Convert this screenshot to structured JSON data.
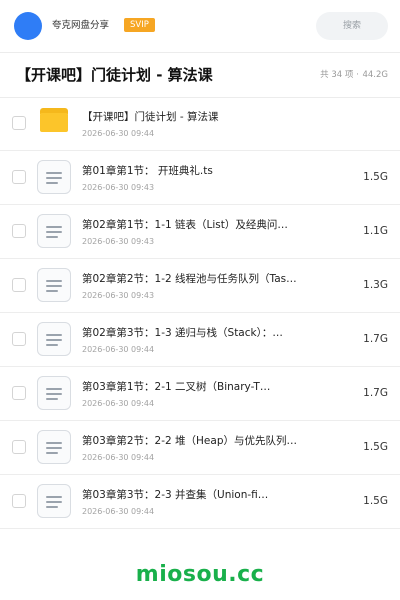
{
  "header": {
    "app_name": "夸克网盘分享",
    "badge": "SVIP",
    "search_placeholder": "搜索",
    "avatar_color": "#2f7df6",
    "badge_color": "#f6a623"
  },
  "folder": {
    "title": "【开课吧】门徒计划 - 算法课",
    "count_label": "共 34 项",
    "total_size": "44.2G"
  },
  "items": [
    {
      "type": "folder",
      "icon": "folder-icon",
      "name": "【开课吧】门徒计划 - 算法课",
      "date": "2026-06-30 09:44",
      "size": ""
    },
    {
      "type": "file",
      "icon": "file-icon",
      "name": "第01章第1节： 开班典礼.ts",
      "date": "2026-06-30 09:43",
      "size": "1.5G"
    },
    {
      "type": "file",
      "icon": "file-icon",
      "name": "第02章第1节：1-1 链表（List）及经典问…",
      "date": "2026-06-30 09:43",
      "size": "1.1G"
    },
    {
      "type": "file",
      "icon": "file-icon",
      "name": "第02章第2节：1-2 线程池与任务队列（Tas…",
      "date": "2026-06-30 09:43",
      "size": "1.3G"
    },
    {
      "type": "file",
      "icon": "file-icon",
      "name": "第02章第3节：1-3 递归与栈（Stack）：…",
      "date": "2026-06-30 09:44",
      "size": "1.7G"
    },
    {
      "type": "file",
      "icon": "file-icon",
      "name": "第03章第1节：2-1 二叉树（Binary-T…",
      "date": "2026-06-30 09:44",
      "size": "1.7G"
    },
    {
      "type": "file",
      "icon": "file-icon",
      "name": "第03章第2节：2-2 堆（Heap）与优先队列…",
      "date": "2026-06-30 09:44",
      "size": "1.5G"
    },
    {
      "type": "file",
      "icon": "file-icon",
      "name": "第03章第3节：2-3 并查集（Union-fi…",
      "date": "2026-06-30 09:44",
      "size": "1.5G"
    }
  ],
  "watermark": "miosou.cc",
  "watermark_color": "#19b04b"
}
